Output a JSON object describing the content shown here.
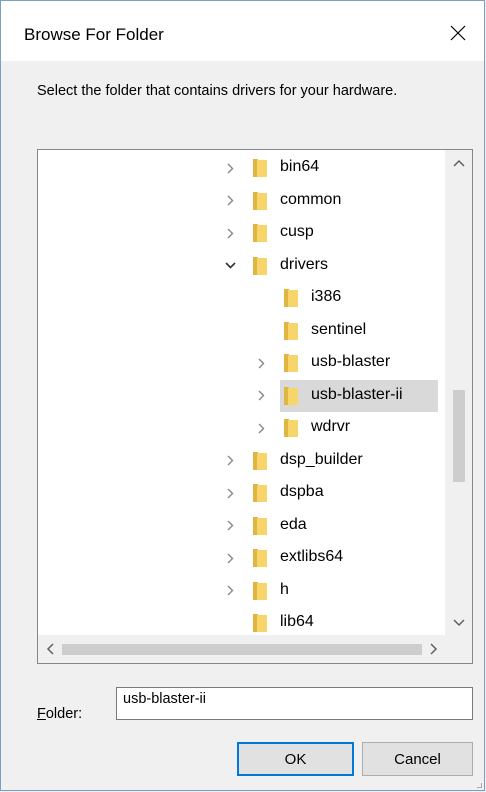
{
  "window": {
    "title": "Browse For Folder"
  },
  "instruction": "Select the folder that contains drivers for your hardware.",
  "tree": [
    {
      "label": "bin64",
      "level": 0,
      "expander": "collapsed",
      "selected": false
    },
    {
      "label": "common",
      "level": 0,
      "expander": "collapsed",
      "selected": false
    },
    {
      "label": "cusp",
      "level": 0,
      "expander": "collapsed",
      "selected": false
    },
    {
      "label": "drivers",
      "level": 0,
      "expander": "expanded",
      "selected": false
    },
    {
      "label": "i386",
      "level": 1,
      "expander": "none",
      "selected": false
    },
    {
      "label": "sentinel",
      "level": 1,
      "expander": "none",
      "selected": false
    },
    {
      "label": "usb-blaster",
      "level": 1,
      "expander": "collapsed",
      "selected": false
    },
    {
      "label": "usb-blaster-ii",
      "level": 1,
      "expander": "collapsed",
      "selected": true
    },
    {
      "label": "wdrvr",
      "level": 1,
      "expander": "collapsed",
      "selected": false
    },
    {
      "label": "dsp_builder",
      "level": 0,
      "expander": "collapsed",
      "selected": false
    },
    {
      "label": "dspba",
      "level": 0,
      "expander": "collapsed",
      "selected": false
    },
    {
      "label": "eda",
      "level": 0,
      "expander": "collapsed",
      "selected": false
    },
    {
      "label": "extlibs64",
      "level": 0,
      "expander": "collapsed",
      "selected": false
    },
    {
      "label": "h",
      "level": 0,
      "expander": "collapsed",
      "selected": false
    },
    {
      "label": "lib64",
      "level": 0,
      "expander": "none",
      "selected": false
    }
  ],
  "folder_field": {
    "label_accel": "F",
    "label_rest": "older:",
    "value": "usb-blaster-ii"
  },
  "buttons": {
    "ok": "OK",
    "cancel": "Cancel"
  },
  "icons": {
    "close": "close-icon",
    "folder": "folder-icon",
    "expand": "chevron-right-icon",
    "collapse": "chevron-down-icon"
  },
  "colors": {
    "folder_yellow": "#f8d56b",
    "folder_dark": "#e1b542",
    "selection": "#d9d9d9",
    "default_button_border": "#0078d7"
  }
}
